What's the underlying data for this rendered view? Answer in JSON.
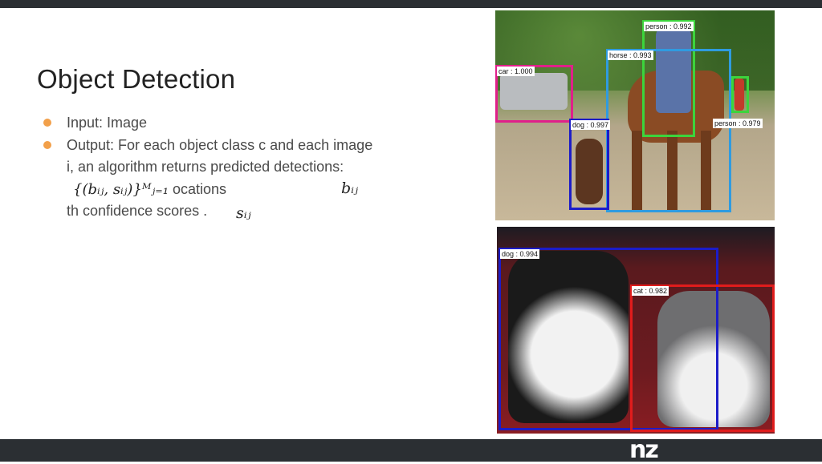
{
  "slide": {
    "title": "Object Detection",
    "bullets": [
      {
        "text": "Input: Image"
      },
      {
        "text_1": "Output: For each object class c and each image i, an algorithm returns predicted detections:",
        "math_1": "{(b",
        "text_2": "ocations",
        "text_3": "th confidence scores",
        "text_4": "."
      }
    ],
    "math_detection_set": "{(bᵢⱼ, sᵢⱼ)}ᴹⱼ₌₁",
    "math_b": "bᵢⱼ",
    "math_s": "sᵢⱼ"
  },
  "image_top": {
    "detections": [
      {
        "label": "person : 0.992",
        "color": "#3cd43c"
      },
      {
        "label": "horse : 0.993",
        "color": "#2f9be0"
      },
      {
        "label": "car : 1.000",
        "color": "#e0208a"
      },
      {
        "label": "dog : 0.997",
        "color": "#1c1cc8"
      },
      {
        "label": "person : 0.979",
        "color": "#3cd43c"
      }
    ]
  },
  "image_bottom": {
    "detections": [
      {
        "label": "dog : 0.994",
        "color": "#1c1cc8"
      },
      {
        "label": "cat : 0.982",
        "color": "#e01c1c"
      }
    ]
  },
  "logo": {
    "text": "nz"
  },
  "colors": {
    "bullet": "#f2a04a",
    "bar": "#2b2f33"
  }
}
